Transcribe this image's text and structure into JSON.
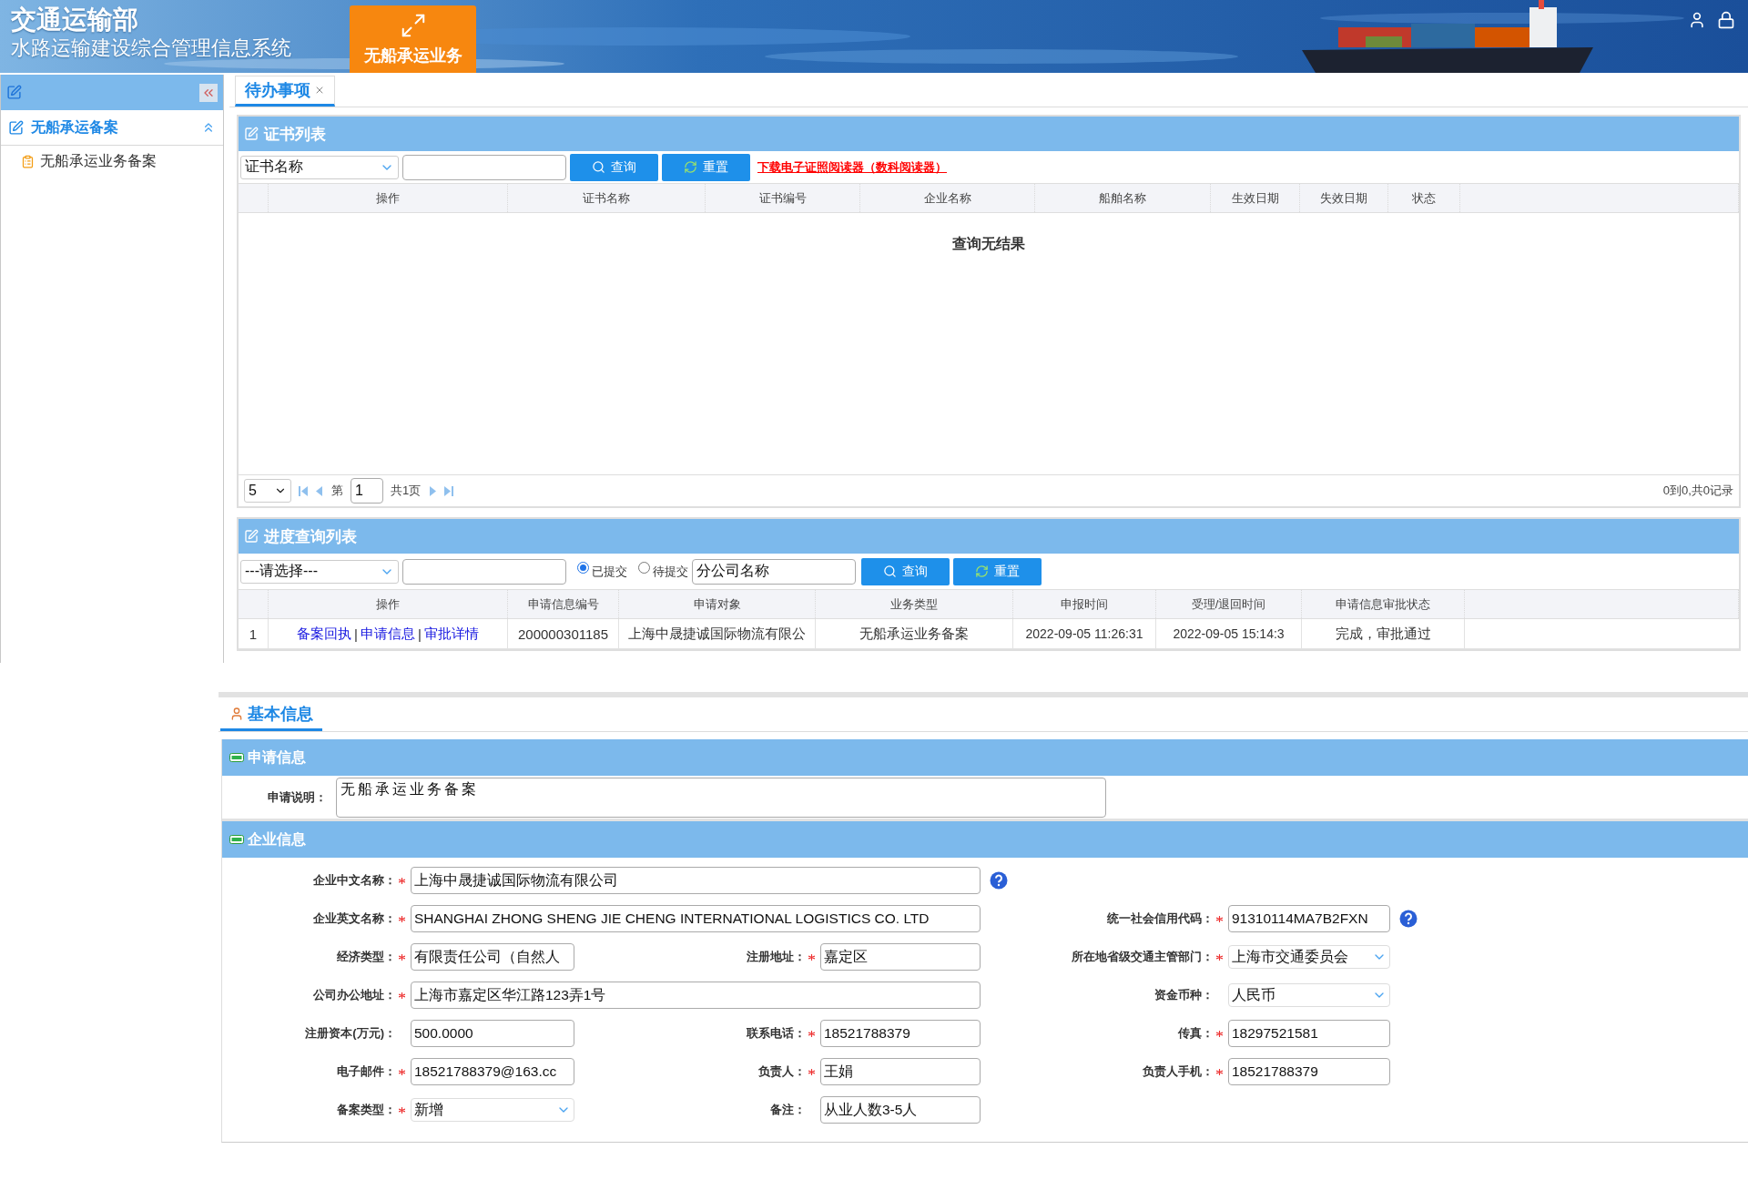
{
  "header": {
    "title": "交通运输部",
    "subtitle": "水路运输建设综合管理信息系统",
    "module_button": "无船承运业务"
  },
  "sidebar": {
    "groups": [
      {
        "label": "无船承运备案",
        "expanded": true,
        "children": [
          {
            "label": "无船承运业务备案"
          }
        ]
      }
    ]
  },
  "tabs": [
    {
      "label": "待办事项",
      "selected": true,
      "closable": true
    }
  ],
  "certificate_panel": {
    "title": "证书列表",
    "filter_select": "证书名称",
    "buttons": [
      {
        "kind": "search",
        "label": "查询"
      },
      {
        "kind": "reset",
        "label": "重置"
      }
    ],
    "download_link": "下载电子证照阅读器（数科阅读器）",
    "columns": [
      "",
      "操作",
      "证书名称",
      "证书编号",
      "企业名称",
      "船舶名称",
      "生效日期",
      "失效日期",
      "状态"
    ],
    "empty_message": "查询无结果",
    "pager": {
      "page_size": "5",
      "page_prefix": "第",
      "page": "1",
      "page_total": "共1页",
      "summary": "0到0,共0记录"
    }
  },
  "progress_panel": {
    "title": "进度查询列表",
    "filter_select": "---请选择---",
    "status_options": [
      {
        "label": "已提交",
        "selected": true
      },
      {
        "label": "待提交",
        "selected": false
      }
    ],
    "branch_field": "分公司名称",
    "buttons": [
      {
        "kind": "search",
        "label": "查询"
      },
      {
        "kind": "reset",
        "label": "重置"
      }
    ],
    "columns": [
      "",
      "操作",
      "申请信息编号",
      "申请对象",
      "业务类型",
      "申报时间",
      "受理/退回时间",
      "申请信息审批状态"
    ],
    "rows": [
      {
        "cells": [
          "1",
          {
            "links": [
              "备案回执",
              "申请信息",
              "审批详情"
            ],
            "separator": "|"
          },
          "200000301185",
          "上海中晟捷诚国际物流有限公",
          "无船承运业务备案",
          "2022-09-05 11:26:31",
          "2022-09-05 15:14:3",
          "完成，审批通过"
        ]
      }
    ]
  },
  "detail": {
    "tabs": [
      {
        "label": "基本信息",
        "selected": true
      }
    ],
    "sections": [
      {
        "kind": "note",
        "title": "申请信息",
        "expanded": true,
        "label": "申请说明：",
        "value": "无船承运业务备案"
      },
      {
        "kind": "form",
        "title": "企业信息",
        "expanded": true,
        "rows": [
          {
            "left": {
              "kind": "wide",
              "label": "企业中文名称：",
              "required": true,
              "value": "上海中晟捷诚国际物流有限公司",
              "help": true
            }
          },
          {
            "left": {
              "kind": "wide",
              "label": "企业英文名称：",
              "required": true,
              "value": "SHANGHAI ZHONG SHENG JIE CHENG INTERNATIONAL LOGISTICS CO. LTD"
            },
            "right": {
              "kind": "input",
              "label": "统一社会信用代码：",
              "required": true,
              "value": "91310114MA7B2FXN",
              "help": true
            }
          },
          {
            "left": {
              "kind": "input",
              "label": "经济类型：",
              "required": true,
              "value": "有限责任公司（自然人"
            },
            "middle": {
              "kind": "input",
              "label": "注册地址：",
              "required": true,
              "value": "嘉定区"
            },
            "right": {
              "kind": "select",
              "label": "所在地省级交通主管部门：",
              "required": true,
              "value": "上海市交通委员会"
            }
          },
          {
            "left": {
              "kind": "wide",
              "label": "公司办公地址：",
              "required": true,
              "value": "上海市嘉定区华江路123弄1号"
            },
            "right": {
              "kind": "select",
              "label": "资金币种：",
              "required": false,
              "value": "人民币"
            }
          },
          {
            "left": {
              "kind": "input",
              "label": "注册资本(万元)：",
              "required": false,
              "value": "500.0000"
            },
            "middle": {
              "kind": "input",
              "label": "联系电话：",
              "required": true,
              "value": "18521788379"
            },
            "right": {
              "kind": "input",
              "label": "传真：",
              "required": true,
              "value": "18297521581"
            }
          },
          {
            "left": {
              "kind": "input",
              "label": "电子邮件：",
              "required": true,
              "value": "18521788379@163.cc"
            },
            "middle": {
              "kind": "input",
              "label": "负责人：",
              "required": true,
              "value": "王娟"
            },
            "right": {
              "kind": "input",
              "label": "负责人手机：",
              "required": true,
              "value": "18521788379"
            }
          },
          {
            "left": {
              "kind": "select",
              "label": "备案类型：",
              "required": true,
              "value": "新增"
            },
            "middle": {
              "kind": "input",
              "label": "备注：",
              "required": false,
              "value": "从业人数3-5人"
            }
          }
        ]
      }
    ]
  }
}
